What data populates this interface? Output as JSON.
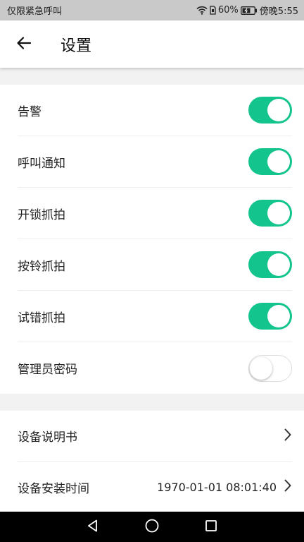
{
  "status_bar": {
    "carrier": "仅限紧急呼叫",
    "battery": "60%",
    "time": "傍晚5:55"
  },
  "header": {
    "title": "设置",
    "back_icon": "arrow-left-icon"
  },
  "toggles": [
    {
      "label": "告警",
      "on": true
    },
    {
      "label": "呼叫通知",
      "on": true
    },
    {
      "label": "开锁抓拍",
      "on": true
    },
    {
      "label": "按铃抓拍",
      "on": true
    },
    {
      "label": "试错抓拍",
      "on": true
    },
    {
      "label": "管理员密码",
      "on": false
    }
  ],
  "links": [
    {
      "label": "设备说明书",
      "value": ""
    },
    {
      "label": "设备安装时间",
      "value": "1970-01-01 08:01:40"
    }
  ],
  "colors": {
    "accent": "#14c48d",
    "status_bar": "#c9c9c9",
    "background": "#f2f2f2"
  }
}
